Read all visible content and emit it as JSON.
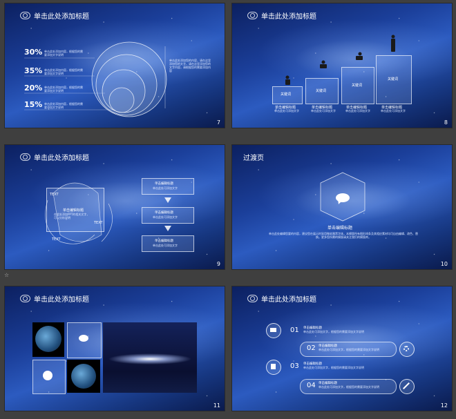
{
  "slide_title": "单击此处添加标题",
  "slides": [
    {
      "num": "7",
      "percents": [
        "30%",
        "35%",
        "20%",
        "15%"
      ],
      "item_text": "单击此处添加内容，根据您的需要添加文字说明",
      "side_text": "单击此处添加您的内容，请在这里添加您的文字，请在这里添加您的文字内容，请根据您的需要添加内容"
    },
    {
      "num": "8",
      "bar_labels": [
        "关键词",
        "关键词",
        "关键词",
        "关键词"
      ],
      "item_title": "单击编辑标题",
      "item_text": "单击此处可添加文字"
    },
    {
      "num": "9",
      "text_labels": [
        "TEXT",
        "TEXT",
        "TEXT"
      ],
      "center_title": "单击编辑标题",
      "center_text": "在此处添加PPT的相关文字，可以分析说明",
      "box_title": "单击编辑标题",
      "box_text": "单击此处可添加文字"
    },
    {
      "num": "10",
      "title": "过渡页",
      "sub_title": "单击编辑标题",
      "body_text": "单击此处编辑您要的内容，建议您在展示时采用微软雅黑字体，本模版所有图形线条及其相应素材均可自由编辑、改色、替换。更多您所需的模版请关注我们的模版库。"
    },
    {
      "num": "11"
    },
    {
      "num": "12",
      "numbers": [
        "01",
        "02",
        "03",
        "04"
      ],
      "item_title": "单击编辑标题",
      "item_text": "单击此处可添加文字，根据您的需要添加文字说明"
    }
  ],
  "sidebar_marker": "☆"
}
